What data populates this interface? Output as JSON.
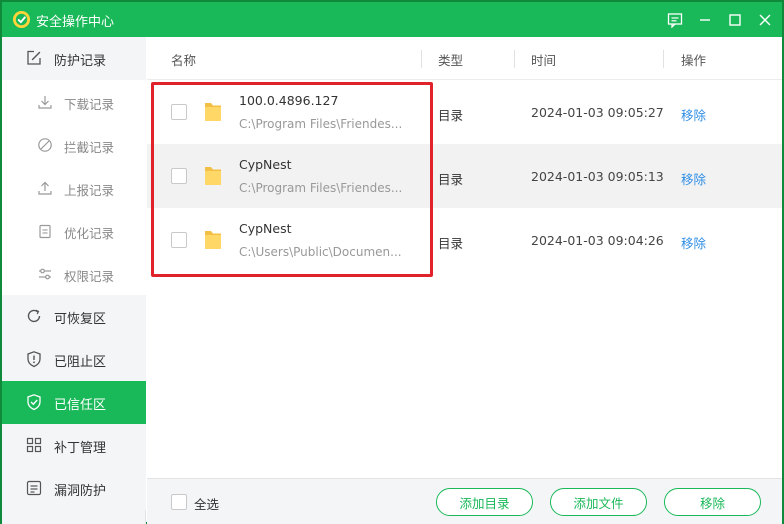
{
  "window": {
    "title": "安全操作中心",
    "accent_color": "#19b858",
    "controls": [
      "feedback-icon",
      "minimize-icon",
      "maximize-icon",
      "close-icon"
    ]
  },
  "sidebar": {
    "protection_records": {
      "label": "防护记录",
      "icon": "edit-icon"
    },
    "sub_items": [
      {
        "label": "下载记录",
        "icon": "download-icon"
      },
      {
        "label": "拦截记录",
        "icon": "block-icon"
      },
      {
        "label": "上报记录",
        "icon": "upload-icon"
      },
      {
        "label": "优化记录",
        "icon": "clipboard-icon"
      },
      {
        "label": "权限记录",
        "icon": "sliders-icon"
      }
    ],
    "groups": [
      {
        "label": "可恢复区",
        "icon": "restore-icon",
        "active": false
      },
      {
        "label": "已阻止区",
        "icon": "shield-alert-icon",
        "active": false
      },
      {
        "label": "已信任区",
        "icon": "shield-check-icon",
        "active": true
      },
      {
        "label": "补丁管理",
        "icon": "grid-icon",
        "active": false
      },
      {
        "label": "漏洞防护",
        "icon": "bug-shield-icon",
        "active": false
      }
    ]
  },
  "table": {
    "columns": [
      "名称",
      "类型",
      "时间",
      "操作"
    ],
    "rows": [
      {
        "name": "100.0.4896.127",
        "path": "C:\\Program Files\\Friendes...",
        "type": "目录",
        "time": "2024-01-03 09:05:27",
        "action": "移除"
      },
      {
        "name": "CypNest",
        "path": "C:\\Program Files\\Friendes...",
        "type": "目录",
        "time": "2024-01-03 09:05:13",
        "action": "移除"
      },
      {
        "name": "CypNest",
        "path": "C:\\Users\\Public\\Documen...",
        "type": "目录",
        "time": "2024-01-03 09:04:26",
        "action": "移除"
      }
    ]
  },
  "footer": {
    "select_all": "全选",
    "add_directory": "添加目录",
    "add_file": "添加文件",
    "remove": "移除"
  }
}
